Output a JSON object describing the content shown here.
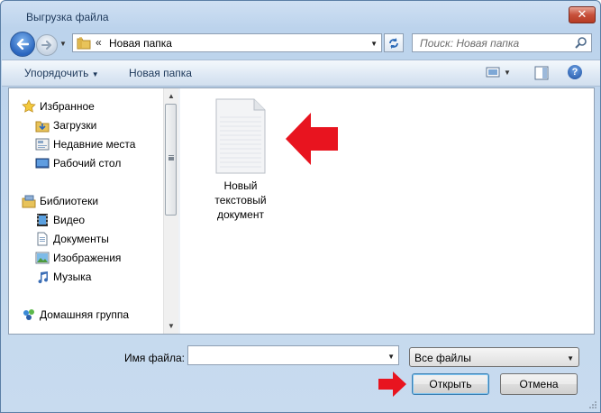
{
  "window": {
    "title": "Выгрузка файла"
  },
  "address": {
    "path_chevron": "«",
    "path": "Новая папка"
  },
  "search": {
    "placeholder": "Поиск: Новая папка"
  },
  "toolbar": {
    "organize": "Упорядочить",
    "new_folder": "Новая папка"
  },
  "navpane": {
    "favorites_header": "Избранное",
    "favorites": [
      "Загрузки",
      "Недавние места",
      "Рабочий стол"
    ],
    "libraries_header": "Библиотеки",
    "libraries": [
      "Видео",
      "Документы",
      "Изображения",
      "Музыка"
    ],
    "homegroup": "Домашняя группа"
  },
  "files": [
    {
      "name_lines": [
        "Новый",
        "текстовый",
        "документ"
      ]
    }
  ],
  "bottom": {
    "filename_label": "Имя файла:",
    "filename_value": "",
    "filetype_selected": "Все файлы",
    "open_button": "Открыть",
    "cancel_button": "Отмена"
  },
  "colors": {
    "annotation_arrow": "#e8141f",
    "accent": "#2a66bf"
  }
}
